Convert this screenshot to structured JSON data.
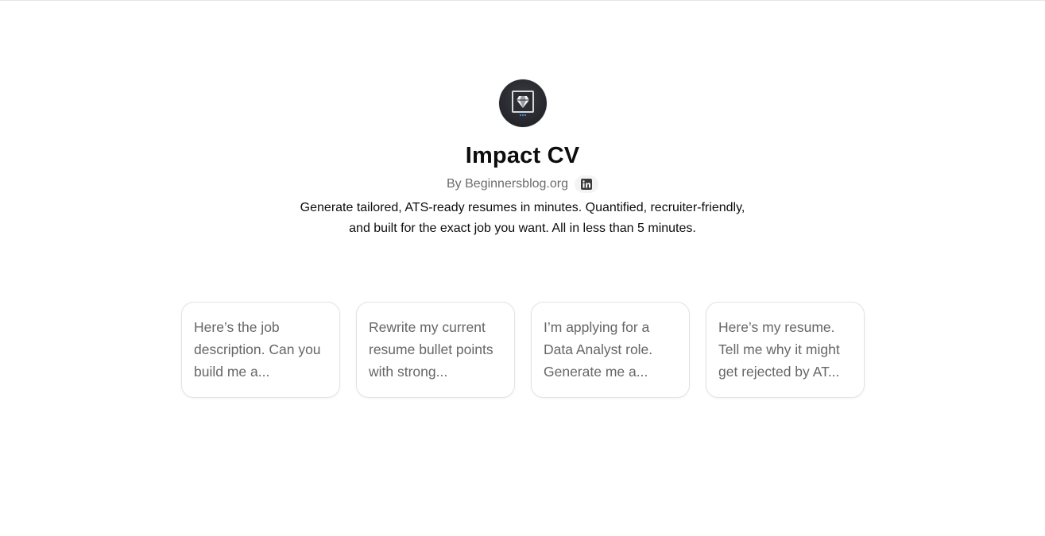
{
  "gpt": {
    "avatar_icon": "diamond-monitor-icon",
    "name": "Impact CV",
    "author": "By Beginnersblog.org",
    "social_icon": "linkedin-icon",
    "description": "Generate tailored, ATS-ready resumes in minutes. Quantified, recruiter-friendly, and built for the exact job you want. All in less than 5 minutes."
  },
  "starters": [
    {
      "text": "Here’s the job description. Can you build me a..."
    },
    {
      "text": "Rewrite my current resume bullet points with strong..."
    },
    {
      "text": "I’m applying for a Data Analyst role. Generate me a..."
    },
    {
      "text": "Here’s my resume. Tell me why it might get rejected by AT..."
    }
  ],
  "colors": {
    "text_primary": "#0d0d0d",
    "text_secondary": "#6b6b6b",
    "card_border": "#e3e3e3",
    "avatar_bg": "#24262b"
  }
}
